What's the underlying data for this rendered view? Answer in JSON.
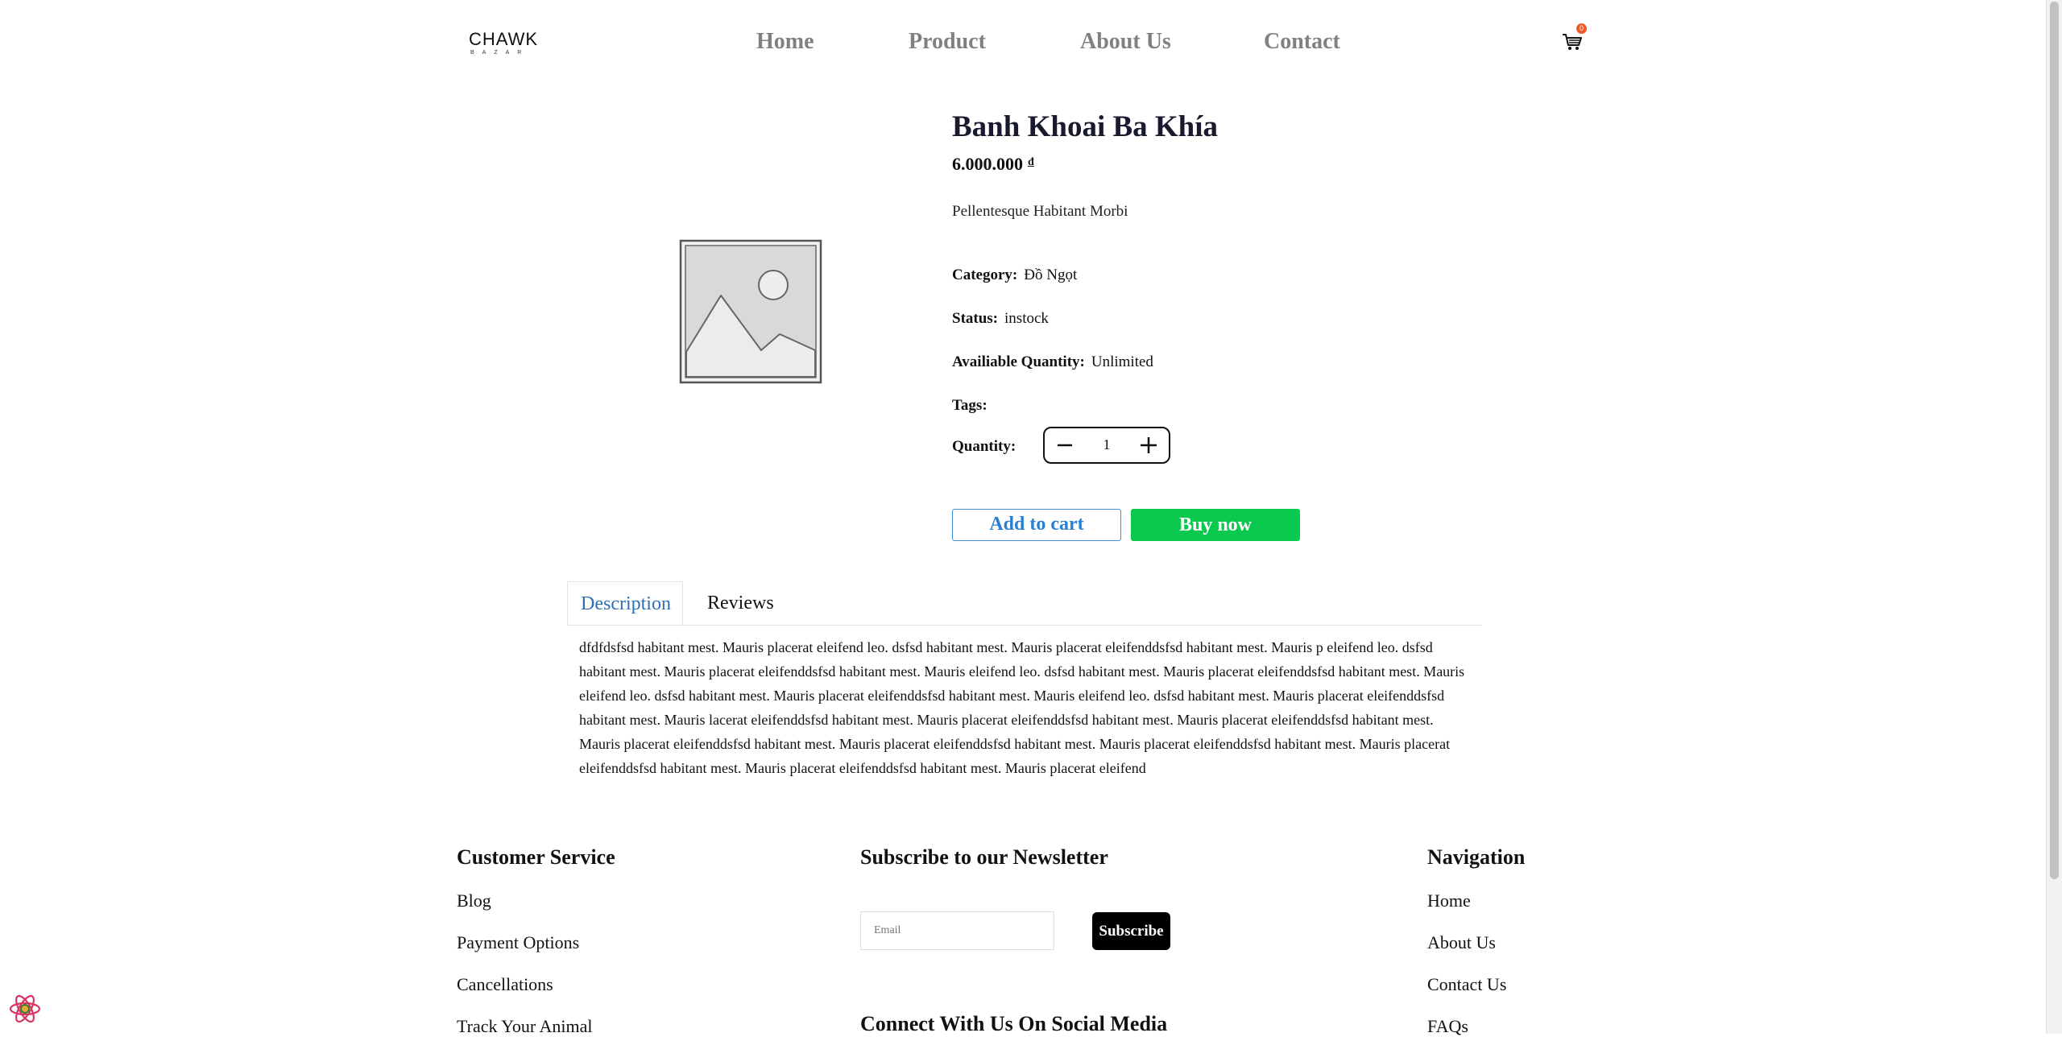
{
  "header": {
    "logo_main": "CHAWK",
    "logo_sub": "BAZAR",
    "nav": [
      "Home",
      "Product",
      "About Us",
      "Contact"
    ],
    "cart_count": "0"
  },
  "product": {
    "title": "Banh Khoai Ba Khía",
    "price": "6.000.000",
    "currency": "đ",
    "subtitle": "Pellentesque Habitant Morbi",
    "category_label": "Category:",
    "category": "Đồ Ngọt",
    "status_label": "Status:",
    "status": "instock",
    "qty_avail_label": "Availiable Quantity:",
    "qty_avail": "Unlimited",
    "tags_label": "Tags:",
    "quantity_label": "Quantity:",
    "quantity": "1",
    "add_to_cart": "Add to cart",
    "buy_now": "Buy now"
  },
  "tabs": {
    "description": "Description",
    "reviews": "Reviews"
  },
  "description_text": "dfdfdsfsd habitant mest. Mauris placerat eleifend leo. dsfsd habitant mest. Mauris placerat eleifenddsfsd habitant mest. Mauris p eleifend leo. dsfsd habitant mest. Mauris placerat eleifenddsfsd habitant mest. Mauris eleifend leo. dsfsd habitant mest. Mauris placerat eleifenddsfsd habitant mest. Mauris eleifend leo. dsfsd habitant mest. Mauris placerat eleifenddsfsd habitant mest. Mauris eleifend leo. dsfsd habitant mest. Mauris placerat eleifenddsfsd habitant mest. Mauris lacerat eleifenddsfsd habitant mest. Mauris placerat eleifenddsfsd habitant mest. Mauris placerat eleifenddsfsd habitant mest. Mauris placerat eleifenddsfsd habitant mest. Mauris placerat eleifenddsfsd habitant mest. Mauris placerat eleifenddsfsd habitant mest. Mauris placerat eleifenddsfsd habitant mest. Mauris placerat eleifenddsfsd habitant mest. Mauris placerat eleifend",
  "footer": {
    "customer_service": {
      "heading": "Customer Service",
      "links": [
        "Blog",
        "Payment Options",
        "Cancellations",
        "Track Your Animal"
      ]
    },
    "newsletter": {
      "heading": "Subscribe to our Newsletter",
      "email_placeholder": "Email",
      "subscribe": "Subscribe",
      "social_heading": "Connect With Us On Social Media"
    },
    "navigation": {
      "heading": "Navigation",
      "links": [
        "Home",
        "About Us",
        "Contact Us",
        "FAQs"
      ]
    }
  },
  "colors": {
    "nav_text": "#808080",
    "add_to_cart": "#2a7fd0",
    "buy_now": "#0bc84f",
    "tab_active": "#2f6fb5",
    "cart_badge": "#f05a28"
  }
}
